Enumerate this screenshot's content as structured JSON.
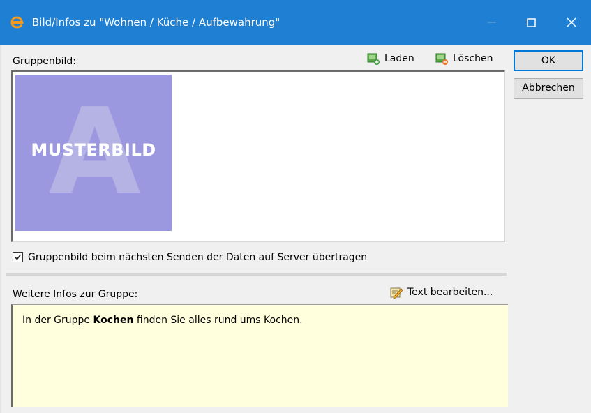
{
  "window": {
    "title": "Bild/Infos zu \"Wohnen / Küche / Aufbewahrung\"",
    "accent_color": "#1f7fd3"
  },
  "group_image": {
    "label": "Gruppenbild:",
    "load_label": "Laden",
    "delete_label": "Löschen",
    "placeholder_caption": "MUSTERBILD",
    "placeholder_letter": "A"
  },
  "upload_option": {
    "checked": true,
    "label": "Gruppenbild beim nächsten Senden der Daten auf Server übertragen"
  },
  "group_info": {
    "label": "Weitere Infos zur Gruppe:",
    "edit_label": "Text bearbeiten...",
    "text_before": "In der Gruppe ",
    "text_bold": "Kochen",
    "text_after": " finden Sie alles rund ums Kochen."
  },
  "buttons": {
    "ok_label": "OK",
    "cancel_label": "Abbrechen"
  }
}
